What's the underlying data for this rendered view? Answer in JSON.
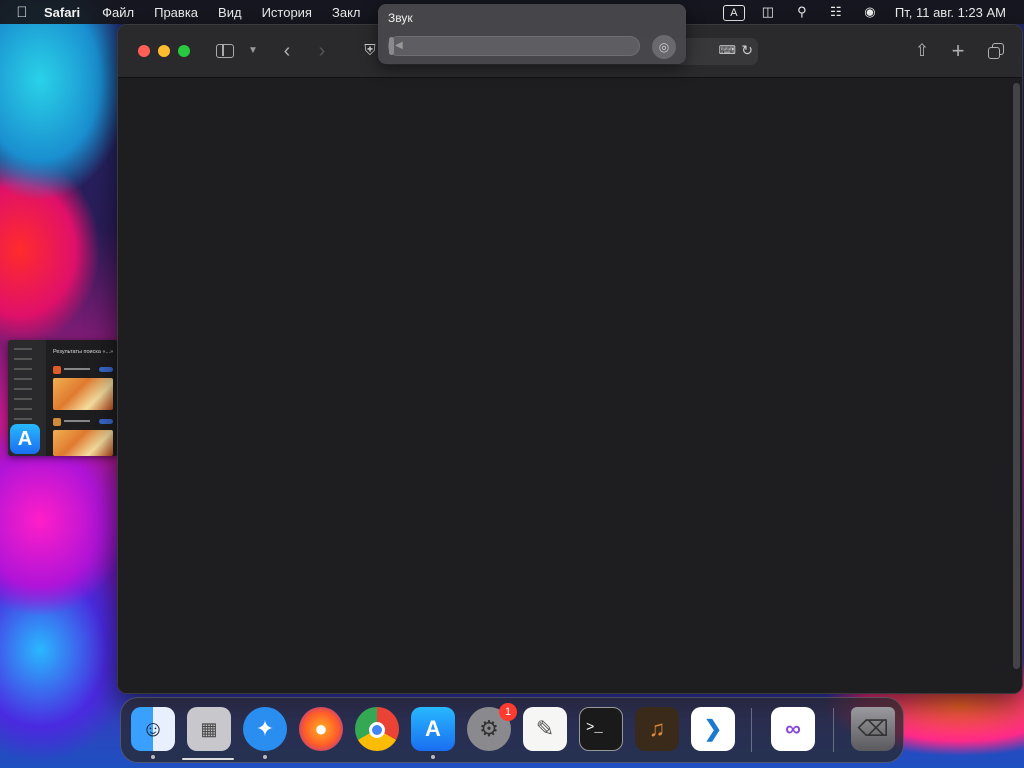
{
  "menubar": {
    "app_name": "Safari",
    "items": [
      "Файл",
      "Правка",
      "Вид",
      "История",
      "Закл"
    ],
    "input_source": "A",
    "clock": "Пт, 11 авг.  1:23 AM"
  },
  "sound_popover": {
    "title": "Звук",
    "volume_level": 0.02
  },
  "side_thumbnail": {
    "heading": "Результаты поиска «...»"
  },
  "dock": {
    "apps": [
      {
        "name": "Finder",
        "icon": "finder-icon",
        "running": true
      },
      {
        "name": "Launchpad",
        "icon": "launchpad-icon",
        "running": true
      },
      {
        "name": "Safari",
        "icon": "safari-icon",
        "running": true
      },
      {
        "name": "Firefox",
        "icon": "firefox-icon",
        "running": false
      },
      {
        "name": "Chrome",
        "icon": "chrome-icon",
        "running": false
      },
      {
        "name": "App Store",
        "icon": "app-store-icon",
        "running": true
      },
      {
        "name": "System Settings",
        "icon": "system-settings-icon",
        "running": false,
        "badge": "1"
      },
      {
        "name": "TextEdit",
        "icon": "textedit-icon",
        "running": false
      },
      {
        "name": "Terminal",
        "icon": "terminal-icon",
        "running": false
      },
      {
        "name": "GarageBand",
        "icon": "garageband-icon",
        "running": false
      },
      {
        "name": "Visual Studio Code",
        "icon": "vscode-icon",
        "running": false
      },
      {
        "name": "Visual Studio",
        "icon": "visual-studio-icon",
        "running": false
      },
      {
        "name": "Trash",
        "icon": "trash-icon",
        "running": false
      }
    ]
  },
  "colors": {
    "window_bg": "#1e1e20",
    "toolbar_bg": "#2a2a2c",
    "close": "#ff5f57",
    "minimize": "#febc2e",
    "zoom": "#28c840",
    "badge": "#ff3b30"
  }
}
